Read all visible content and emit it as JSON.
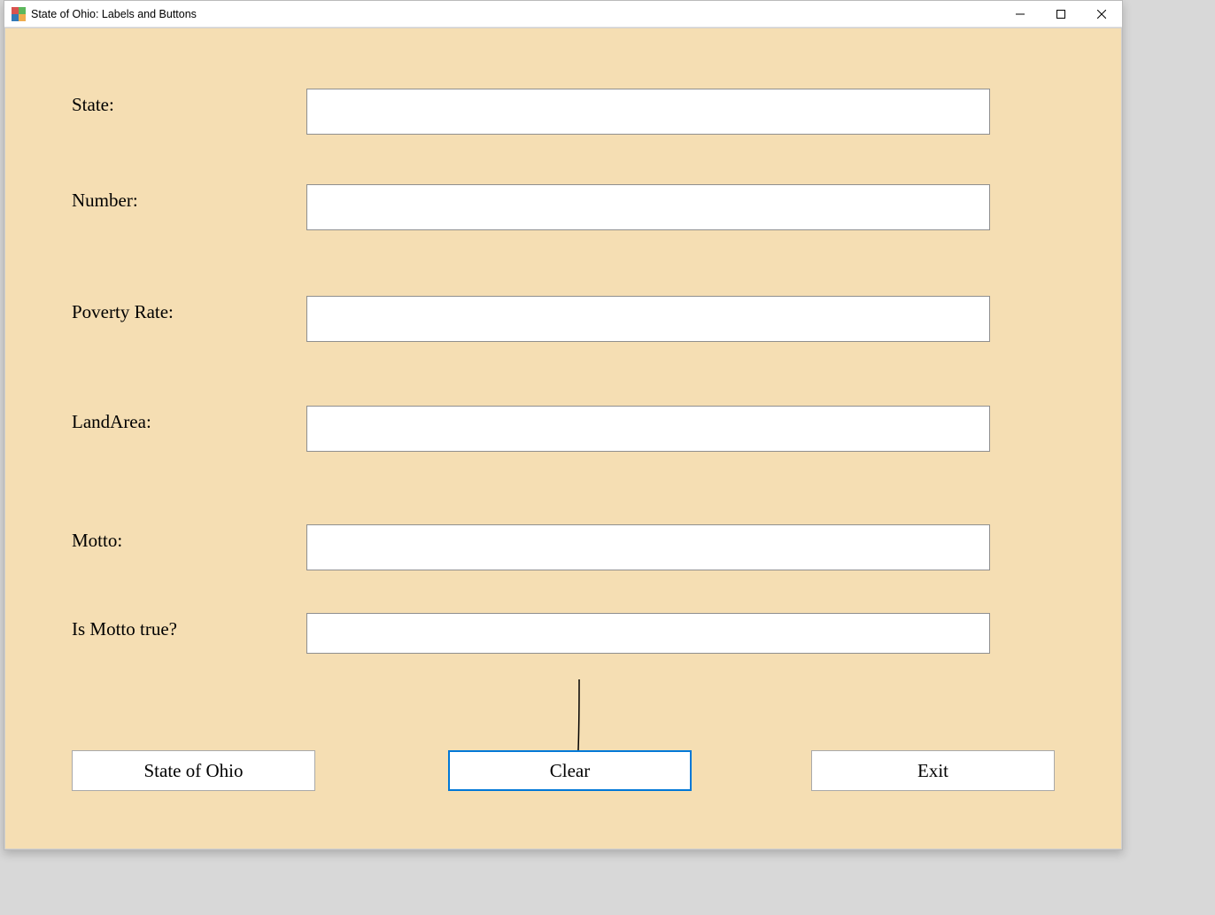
{
  "window": {
    "title": "State of Ohio: Labels and Buttons"
  },
  "labels": {
    "state": "State:",
    "number": "Number:",
    "poverty": "Poverty Rate:",
    "landarea": "LandArea:",
    "motto": "Motto:",
    "ismottotrue": "Is Motto true?"
  },
  "fields": {
    "state": "",
    "number": "",
    "poverty": "",
    "landarea": "",
    "motto": "",
    "ismottotrue": ""
  },
  "buttons": {
    "stateofohio": "State of Ohio",
    "clear": "Clear",
    "exit": "Exit"
  }
}
